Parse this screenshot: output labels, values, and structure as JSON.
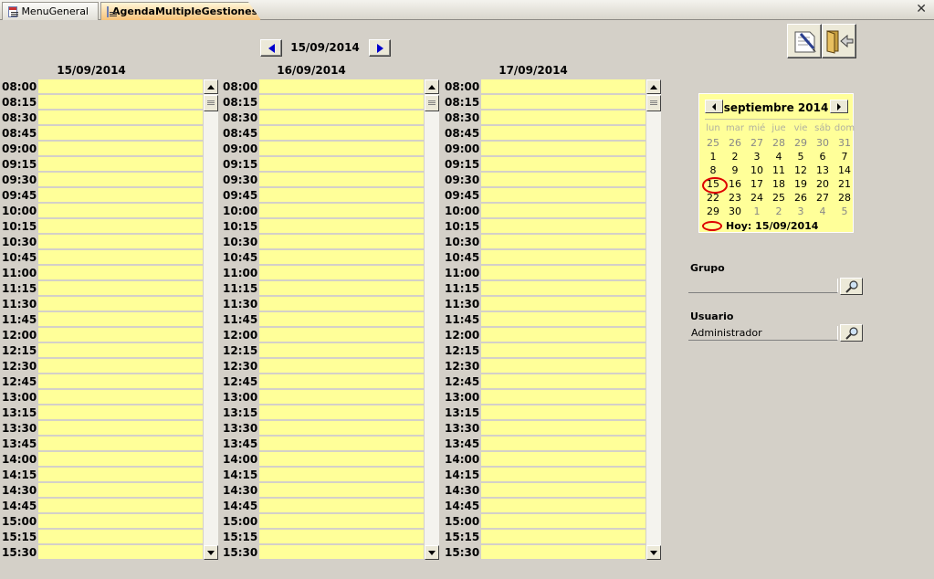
{
  "tabs": [
    {
      "label": "MenuGeneral",
      "active": false
    },
    {
      "label": "AgendaMultipleGestiones",
      "active": true
    }
  ],
  "close_icon": "close-icon",
  "navigator": {
    "current_date": "15/09/2014",
    "prev_icon": "arrow-left-icon",
    "next_icon": "arrow-right-icon"
  },
  "actions": [
    {
      "name": "notes-button",
      "icon": "note-pencil-icon"
    },
    {
      "name": "exit-button",
      "icon": "door-exit-icon"
    }
  ],
  "days": [
    {
      "header": "15/09/2014"
    },
    {
      "header": "16/09/2014"
    },
    {
      "header": "17/09/2014"
    }
  ],
  "times": [
    "08:00",
    "08:15",
    "08:30",
    "08:45",
    "09:00",
    "09:15",
    "09:30",
    "09:45",
    "10:00",
    "10:15",
    "10:30",
    "10:45",
    "11:00",
    "11:15",
    "11:30",
    "11:45",
    "12:00",
    "12:15",
    "12:30",
    "12:45",
    "13:00",
    "13:15",
    "13:30",
    "13:45",
    "14:00",
    "14:15",
    "14:30",
    "14:45",
    "15:00",
    "15:15",
    "15:30"
  ],
  "calendar": {
    "month_label": "septiembre 2014",
    "weekdays": [
      "lun",
      "mar",
      "mié",
      "jue",
      "vie",
      "sáb",
      "dom"
    ],
    "weeks": [
      [
        {
          "d": "25",
          "o": true
        },
        {
          "d": "26",
          "o": true
        },
        {
          "d": "27",
          "o": true
        },
        {
          "d": "28",
          "o": true
        },
        {
          "d": "29",
          "o": true
        },
        {
          "d": "30",
          "o": true
        },
        {
          "d": "31",
          "o": true
        }
      ],
      [
        {
          "d": "1"
        },
        {
          "d": "2"
        },
        {
          "d": "3"
        },
        {
          "d": "4"
        },
        {
          "d": "5"
        },
        {
          "d": "6"
        },
        {
          "d": "7"
        }
      ],
      [
        {
          "d": "8"
        },
        {
          "d": "9"
        },
        {
          "d": "10"
        },
        {
          "d": "11"
        },
        {
          "d": "12"
        },
        {
          "d": "13"
        },
        {
          "d": "14"
        }
      ],
      [
        {
          "d": "15",
          "t": true
        },
        {
          "d": "16"
        },
        {
          "d": "17"
        },
        {
          "d": "18"
        },
        {
          "d": "19"
        },
        {
          "d": "20"
        },
        {
          "d": "21"
        }
      ],
      [
        {
          "d": "22"
        },
        {
          "d": "23"
        },
        {
          "d": "24"
        },
        {
          "d": "25"
        },
        {
          "d": "26"
        },
        {
          "d": "27"
        },
        {
          "d": "28"
        }
      ],
      [
        {
          "d": "29"
        },
        {
          "d": "30"
        },
        {
          "d": "1",
          "o": true
        },
        {
          "d": "2",
          "o": true
        },
        {
          "d": "3",
          "o": true
        },
        {
          "d": "4",
          "o": true
        },
        {
          "d": "5",
          "o": true
        }
      ]
    ],
    "today_label": "Hoy: 15/09/2014",
    "today_color": "#dd0000"
  },
  "grupo": {
    "label": "Grupo",
    "value": ""
  },
  "usuario": {
    "label": "Usuario",
    "value": "Administrador"
  },
  "colors": {
    "slot_bg": "#ffff99",
    "form_bg": "#d4d0c8",
    "active_tab": "#f7c27a"
  }
}
